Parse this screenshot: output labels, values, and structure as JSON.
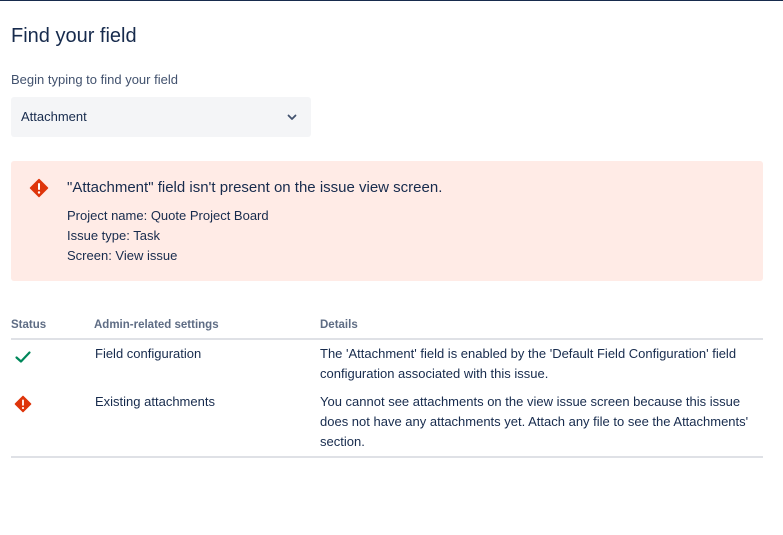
{
  "page": {
    "title": "Find your field"
  },
  "field_picker": {
    "label": "Begin typing to find your field",
    "selected_value": "Attachment",
    "chevron_icon": "chevron-down-icon"
  },
  "alert": {
    "icon": "error-icon",
    "title": "\"Attachment\" field isn't present on the issue view screen.",
    "lines": [
      "Project name: Quote Project Board",
      "Issue type: Task",
      "Screen: View issue"
    ],
    "background": "#ffebe6",
    "icon_color": "#de350b"
  },
  "table": {
    "headers": {
      "status": "Status",
      "settings": "Admin-related settings",
      "details": "Details"
    },
    "rows": [
      {
        "status_icon": "check-icon",
        "status_color": "#00875a",
        "setting": "Field configuration",
        "details": "The 'Attachment' field is enabled by the 'Default Field Configuration' field configuration associated with this issue."
      },
      {
        "status_icon": "error-icon",
        "status_color": "#de350b",
        "setting": "Existing attachments",
        "details": "You cannot see attachments on the view issue screen because this issue does not have any attachments yet. Attach any file to see the Attachments' section."
      }
    ]
  }
}
